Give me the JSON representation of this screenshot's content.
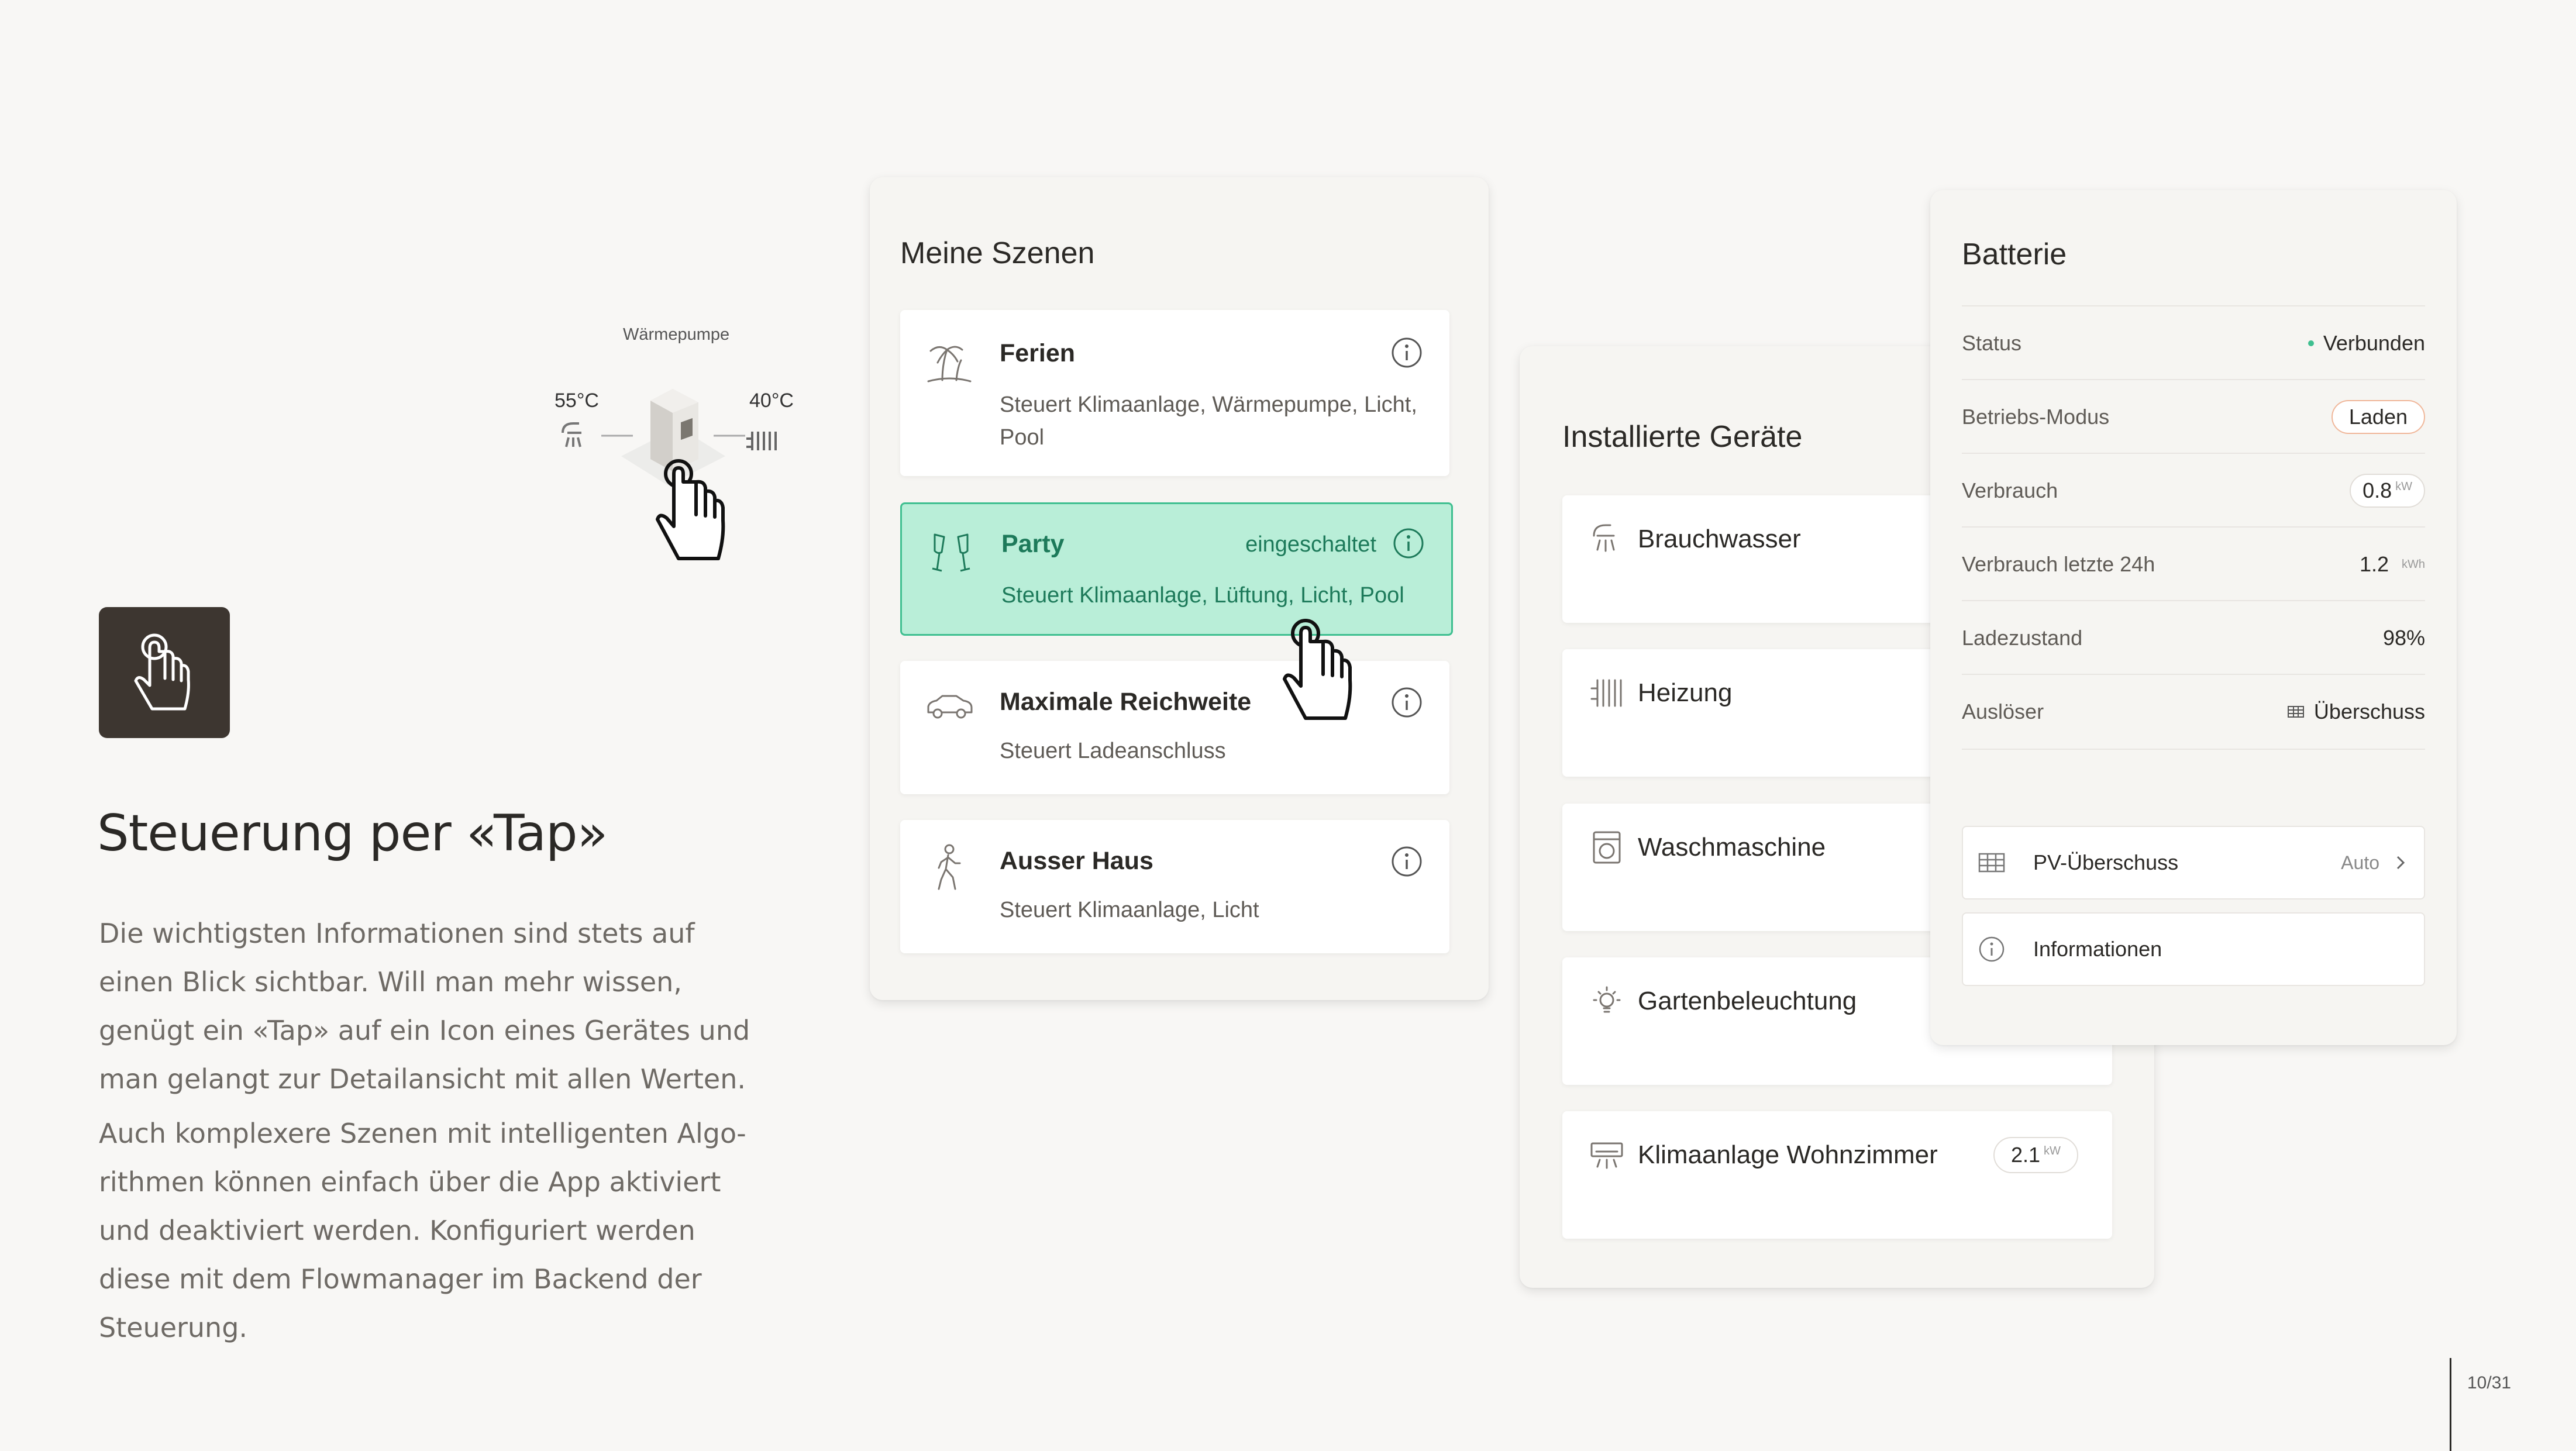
{
  "left": {
    "headline": "Steuerung per «Tap»",
    "paragraph_1": "Die wichtigsten Informationen sind stets auf einen Blick sichtbar. Will man mehr wissen, genügt ein «Tap» auf ein Icon eines Gerätes und man gelangt zur Detailansicht mit allen Werten.",
    "paragraph_2": "Auch komplexere Szenen mit intelligenten Algo­rithmen können einfach über die App aktiviert und deaktiviert werden. Konfiguriert werden diese mit dem Flowmanager im Backend der Steuerung.",
    "illustration": {
      "title": "Wärmepumpe",
      "left_temp": "55°C",
      "right_temp": "40°C"
    }
  },
  "scenes": {
    "title": "Meine Szenen",
    "items": [
      {
        "title": "Ferien",
        "desc": "Steuert  Klimaanlage, Wärmepumpe, Licht, Pool",
        "icon": "palm-icon"
      },
      {
        "title": "Party",
        "desc": "Steuert  Klimaanlage, Lüftung, Licht, Pool",
        "status": "eingeschaltet",
        "icon": "glasses-icon"
      },
      {
        "title": "Maximale Reichweite",
        "desc": "Steuert  Ladeanschluss",
        "icon": "car-icon"
      },
      {
        "title": "Ausser Haus",
        "desc": "Steuert  Klimaanlage, Licht",
        "icon": "walking-person-icon"
      }
    ]
  },
  "devices": {
    "title": "Installierte Geräte",
    "items": [
      {
        "label": "Brauchwasser",
        "icon": "shower-icon"
      },
      {
        "label": "Heizung",
        "icon": "radiator-icon"
      },
      {
        "label": "Waschmaschine",
        "icon": "washing-machine-icon"
      },
      {
        "label": "Gartenbeleuchtung",
        "icon": "lightbulb-icon"
      },
      {
        "label": "Klimaanlage Wohnzimmer",
        "icon": "air-conditioner-icon",
        "badge_value": "2.1",
        "badge_unit": "kW"
      }
    ]
  },
  "battery": {
    "title": "Batterie",
    "rows": [
      {
        "key": "Status",
        "value": "Verbunden"
      },
      {
        "key": "Betriebs-Modus",
        "value": "Laden"
      },
      {
        "key": "Verbrauch",
        "value": "0.8",
        "unit": "kW"
      },
      {
        "key": "Verbrauch letzte 24h",
        "value": "1.2",
        "unit": "kWh"
      },
      {
        "key": "Ladezustand",
        "value": "98%"
      },
      {
        "key": "Auslöser",
        "value": "Überschuss"
      }
    ],
    "actions": [
      {
        "label": "PV-Überschuss",
        "right": "Auto"
      },
      {
        "label": "Informationen"
      }
    ]
  },
  "page_number": "10/31",
  "colors": {
    "active_bg": "#b9eed8",
    "active_border": "#3fbf90",
    "active_text": "#1d7a5a",
    "tile_bg": "#3d3630"
  }
}
